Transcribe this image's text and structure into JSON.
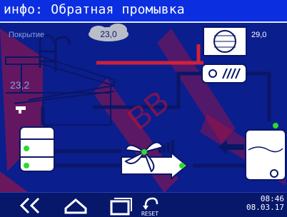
{
  "header": {
    "title": "инфо: Обратная промывка"
  },
  "scene": {
    "pool_cover_label": "Покрытие",
    "outdoor_temp": "23,0",
    "heat_pump_temp": "29,0",
    "pool_water_temp": "23,2"
  },
  "watermark": {
    "text": "ВВ"
  },
  "footer": {
    "reset_label": "RESET",
    "time": "08:46",
    "date": "08.03.17"
  },
  "colors": {
    "background": "#0a1e8e",
    "header": "#0b2fe0",
    "pipe_hot": "#d0213a",
    "pipe_cold": "#0a1666",
    "indicator_green": "#2ed82e",
    "accent_white": "#ffffff"
  }
}
